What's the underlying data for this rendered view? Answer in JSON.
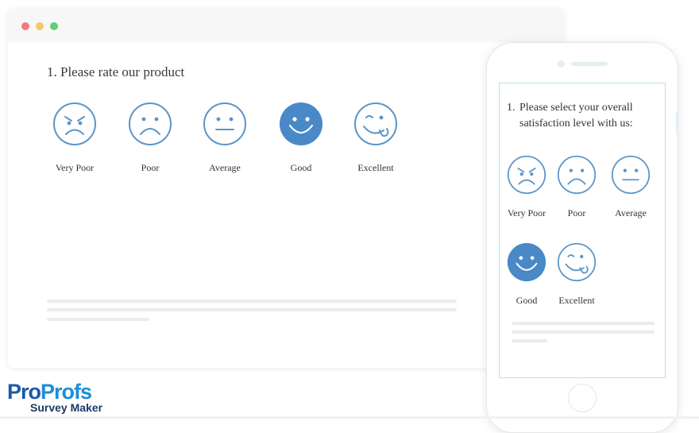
{
  "desktop": {
    "question": "1. Please rate our product",
    "options": [
      {
        "label": "Very Poor",
        "icon": "angry-face-icon",
        "selected": false
      },
      {
        "label": "Poor",
        "icon": "sad-face-icon",
        "selected": false
      },
      {
        "label": "Average",
        "icon": "neutral-face-icon",
        "selected": false
      },
      {
        "label": "Good",
        "icon": "smiling-face-icon",
        "selected": true
      },
      {
        "label": "Excellent",
        "icon": "winking-tongue-face-icon",
        "selected": false
      }
    ]
  },
  "mobile": {
    "question_number": "1.",
    "question_text": "Please select your overall satisfaction level with us:",
    "options": [
      {
        "label": "Very Poor",
        "icon": "angry-face-icon",
        "selected": false
      },
      {
        "label": "Poor",
        "icon": "sad-face-icon",
        "selected": false
      },
      {
        "label": "Average",
        "icon": "neutral-face-icon",
        "selected": false
      },
      {
        "label": "Good",
        "icon": "smiling-face-icon",
        "selected": true
      },
      {
        "label": "Excellent",
        "icon": "winking-tongue-face-icon",
        "selected": false
      }
    ]
  },
  "logo": {
    "part1": "Pro",
    "part2": "Profs",
    "subtitle": "Survey Maker"
  },
  "colors": {
    "icon_stroke": "#5b95c8",
    "selected_fill": "#4a89c8",
    "logo_dark": "#1a5ba6",
    "logo_light": "#1d8ed8"
  }
}
